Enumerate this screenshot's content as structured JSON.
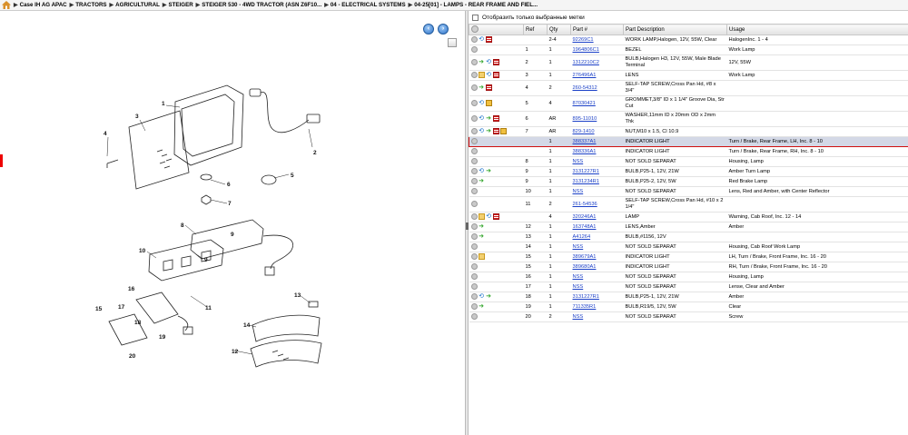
{
  "breadcrumb": [
    "Case IH AG APAC",
    "TRACTORS",
    "AGRICULTURAL",
    "STEIGER",
    "STEIGER 530 - 4WD TRACTOR (ASN Z6F10...",
    "04 - ELECTRICAL SYSTEMS",
    "04-25[01] - LAMPS - REAR FRAME AND FIEL..."
  ],
  "filter": {
    "label": "Отобразить только выбранные метки"
  },
  "columns": {
    "ref": "Ref",
    "qty": "Qty",
    "part": "Part #",
    "desc": "Part Description",
    "usage": "Usage"
  },
  "nav": {
    "prev": "‹",
    "next": "›"
  },
  "diagram": {
    "callouts": [
      "1",
      "2",
      "3",
      "4",
      "5",
      "6",
      "7",
      "8",
      "9",
      "9",
      "10",
      "11",
      "12",
      "13",
      "14",
      "15",
      "16",
      "17",
      "18",
      "19",
      "20"
    ]
  },
  "rows": [
    {
      "icons": [
        "plus",
        "refresh",
        "list"
      ],
      "ref": "",
      "qty": "2-4",
      "part": "92269C1",
      "desc": "WORK LAMP,Halogen, 12V, 55W, Clear",
      "usage": "HalogenInc. 1 - 4"
    },
    {
      "icons": [
        "plus"
      ],
      "ref": "1",
      "qty": "1",
      "part": "1964806C1",
      "desc": "BEZEL",
      "usage": "Work Lamp"
    },
    {
      "icons": [
        "plus",
        "arrow",
        "refresh",
        "list"
      ],
      "ref": "2",
      "qty": "1",
      "part": "1312210C2",
      "desc": "BULB,Halogen H3, 12V, 55W, Male Blade Terminal",
      "usage": "12V, 55W"
    },
    {
      "icons": [
        "plus",
        "folder",
        "refresh",
        "list"
      ],
      "ref": "3",
      "qty": "1",
      "part": "276496A1",
      "desc": "LENS",
      "usage": "Work Lamp"
    },
    {
      "icons": [
        "plus",
        "arrow",
        "list"
      ],
      "ref": "4",
      "qty": "2",
      "part": "260-54312",
      "desc": "SELF-TAP SCREW,Cross Pan Hd, #8 x 3/4\"",
      "usage": ""
    },
    {
      "icons": [
        "plus",
        "refresh",
        "box"
      ],
      "ref": "5",
      "qty": "4",
      "part": "87030421",
      "desc": "GROMMET,3/8\" ID x 1 1/4\" Groove Dia, Str Cut",
      "usage": ""
    },
    {
      "icons": [
        "plus",
        "refresh",
        "arrow",
        "list"
      ],
      "ref": "6",
      "qty": "AR",
      "part": "895-11010",
      "desc": "WASHER,11mm ID x 20mm OD x 2mm Thk",
      "usage": ""
    },
    {
      "icons": [
        "plus",
        "refresh",
        "arrow",
        "list",
        "box"
      ],
      "ref": "7",
      "qty": "AR",
      "part": "829-1410",
      "desc": "NUT,M10 x 1.5, Cl 10.9",
      "usage": ""
    },
    {
      "icons": [
        "plus"
      ],
      "ref": "",
      "qty": "1",
      "part": "388337A1",
      "desc": "INDICATOR LIGHT",
      "usage": "Turn / Brake, Rear Frame, LH, Inc. 8 - 10",
      "selected": true
    },
    {
      "icons": [
        "plus"
      ],
      "ref": "",
      "qty": "1",
      "part": "388336A1",
      "desc": "INDICATOR LIGHT",
      "usage": "Turn / Brake, Rear Frame, RH, Inc. 8 - 10"
    },
    {
      "icons": [
        "plus"
      ],
      "ref": "8",
      "qty": "1",
      "part": "NSS",
      "desc": "NOT SOLD SEPARAT",
      "usage": "Housing, Lamp"
    },
    {
      "icons": [
        "plus",
        "refresh",
        "arrow"
      ],
      "ref": "9",
      "qty": "1",
      "part": "3131227R1",
      "desc": "BULB,P25-1, 12V, 21W",
      "usage": "Amber Turn Lamp"
    },
    {
      "icons": [
        "plus",
        "arrow"
      ],
      "ref": "9",
      "qty": "1",
      "part": "3131234R1",
      "desc": "BULB,P25-2, 12V, 5W",
      "usage": "Red Brake Lamp"
    },
    {
      "icons": [
        "plus"
      ],
      "ref": "10",
      "qty": "1",
      "part": "NSS",
      "desc": "NOT SOLD SEPARAT",
      "usage": "Lens, Red and Amber, with Center Reflector"
    },
    {
      "icons": [
        "plus"
      ],
      "ref": "11",
      "qty": "2",
      "part": "261-54536",
      "desc": "SELF-TAP SCREW,Cross Pan Hd, #10 x 2 1/4\"",
      "usage": ""
    },
    {
      "icons": [
        "plus",
        "folder",
        "refresh",
        "list"
      ],
      "ref": "",
      "qty": "4",
      "part": "320246A1",
      "desc": "LAMP",
      "usage": "Warning, Cab Roof, Inc. 12 - 14"
    },
    {
      "icons": [
        "plus",
        "arrow"
      ],
      "ref": "12",
      "qty": "1",
      "part": "163748A1",
      "desc": "LENS,Amber",
      "usage": "Amber"
    },
    {
      "icons": [
        "plus",
        "arrow"
      ],
      "ref": "13",
      "qty": "1",
      "part": "A41264",
      "desc": "BULB,#1156, 12V",
      "usage": ""
    },
    {
      "icons": [
        "plus"
      ],
      "ref": "14",
      "qty": "1",
      "part": "NSS",
      "desc": "NOT SOLD SEPARAT",
      "usage": "Housing, Cab Roof Work Lamp"
    },
    {
      "icons": [
        "plus",
        "folder"
      ],
      "ref": "15",
      "qty": "1",
      "part": "389679A1",
      "desc": "INDICATOR LIGHT",
      "usage": "LH, Turn / Brake, Front Frame, Inc. 16 - 20"
    },
    {
      "icons": [
        "plus"
      ],
      "ref": "15",
      "qty": "1",
      "part": "389680A1",
      "desc": "INDICATOR LIGHT",
      "usage": "RH, Turn / Brake, Front Frame, Inc. 16 - 20"
    },
    {
      "icons": [
        "plus"
      ],
      "ref": "16",
      "qty": "1",
      "part": "NSS",
      "desc": "NOT SOLD SEPARAT",
      "usage": "Housing, Lamp"
    },
    {
      "icons": [
        "plus"
      ],
      "ref": "17",
      "qty": "1",
      "part": "NSS",
      "desc": "NOT SOLD SEPARAT",
      "usage": "Lense, Clear and Amber"
    },
    {
      "icons": [
        "plus",
        "refresh",
        "arrow"
      ],
      "ref": "18",
      "qty": "1",
      "part": "3131227R1",
      "desc": "BULB,P25-1, 12V, 21W",
      "usage": "Amber"
    },
    {
      "icons": [
        "plus",
        "arrow"
      ],
      "ref": "19",
      "qty": "1",
      "part": "711335R1",
      "desc": "BULB,R19/5, 12V, 5W",
      "usage": "Clear"
    },
    {
      "icons": [
        "plus"
      ],
      "ref": "20",
      "qty": "2",
      "part": "NSS",
      "desc": "NOT SOLD SEPARAT",
      "usage": "Screw"
    }
  ]
}
